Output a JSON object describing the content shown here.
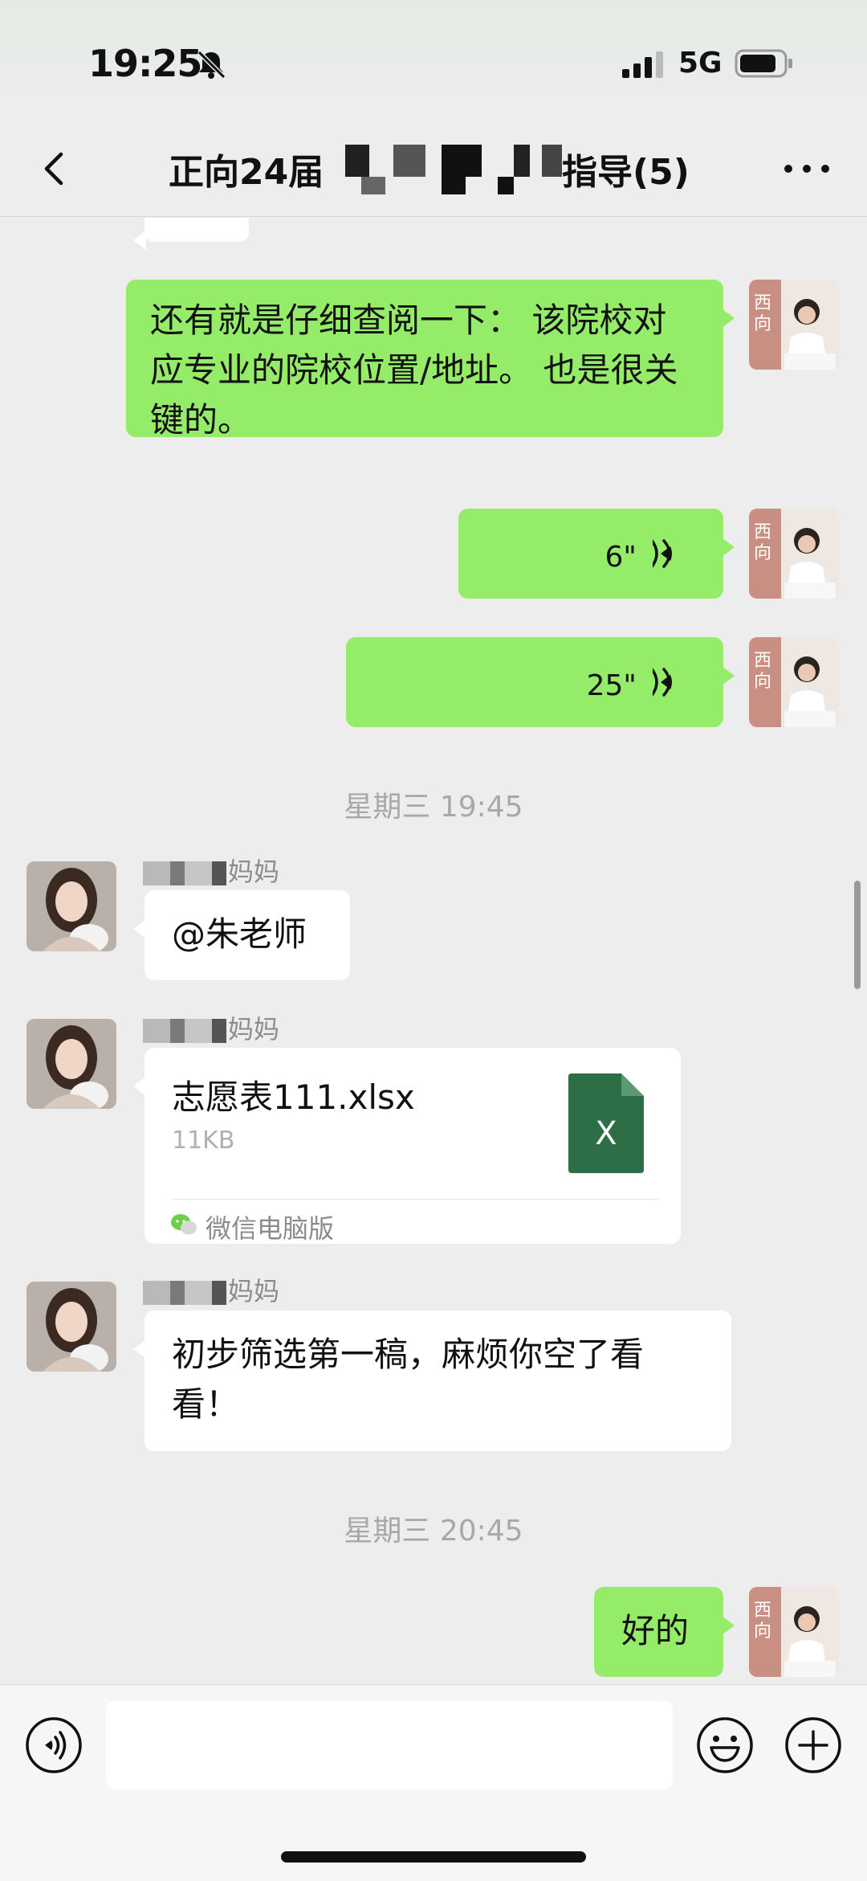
{
  "status": {
    "time": "19:25",
    "network": "5G"
  },
  "header": {
    "title_prefix": "正向24届",
    "title_suffix": "指导(5)"
  },
  "messages": {
    "m1_text": "还有就是仔细查阅一下： 该院校对应专业的院校位置/地址。 也是很关键的。",
    "voice1_length": "6\"",
    "voice2_length": "25\"",
    "time1": "星期三 19:45",
    "sender1": "妈妈",
    "m2_text": "@朱老师",
    "sender2": "妈妈",
    "file": {
      "name": "志愿表111.xlsx",
      "size": "11KB",
      "icon_letter": "X",
      "source": "微信电脑版"
    },
    "sender3": "妈妈",
    "m3_text": "初步筛选第一稿，麻烦你空了看看！",
    "time2": "星期三 20:45",
    "m4_text": "好的"
  },
  "input": {
    "placeholder": ""
  },
  "colors": {
    "outgoing_bubble": "#95ec69",
    "incoming_bubble": "#ffffff",
    "background": "#ededed",
    "excel_green": "#2e6e46"
  }
}
